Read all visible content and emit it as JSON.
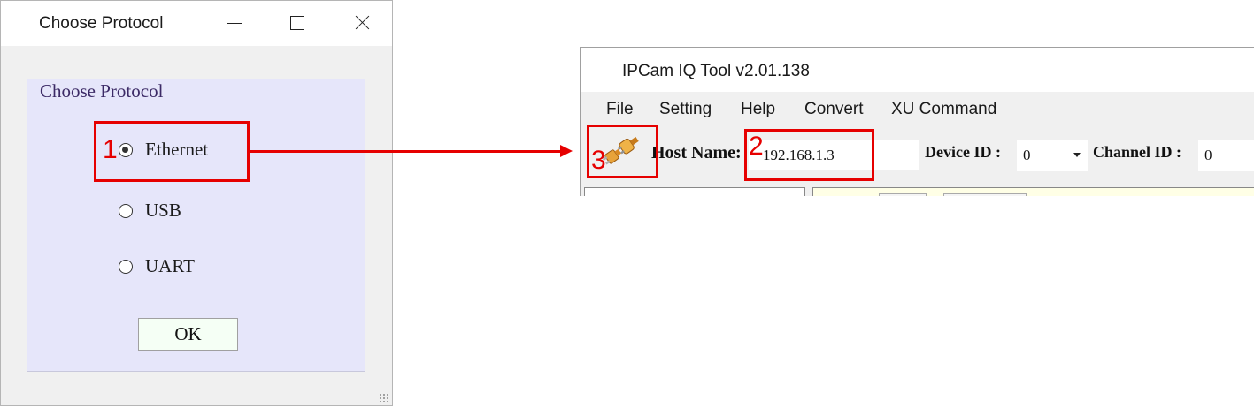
{
  "dialog": {
    "title": "Choose Protocol",
    "group_title": "Choose Protocol",
    "options": [
      {
        "label": "Ethernet",
        "selected": true
      },
      {
        "label": "USB",
        "selected": false
      },
      {
        "label": "UART",
        "selected": false
      }
    ],
    "ok_label": "OK"
  },
  "app": {
    "title": "IPCam IQ Tool v2.01.138",
    "menu": [
      "File",
      "Setting",
      "Help",
      "Convert",
      "XU Command"
    ],
    "host_label": "Host Name:",
    "host_value": "192.168.1.3",
    "device_id_label": "Device ID :",
    "device_id_value": "0",
    "channel_id_label": "Channel ID :",
    "channel_id_value": "0"
  },
  "annotations": {
    "step1": "1",
    "step2": "2",
    "step3": "3",
    "color": "#e60000"
  },
  "icons": [
    "minimize-icon",
    "maximize-icon",
    "close-icon",
    "connect-plug-icon",
    "dropdown-arrow-icon"
  ]
}
